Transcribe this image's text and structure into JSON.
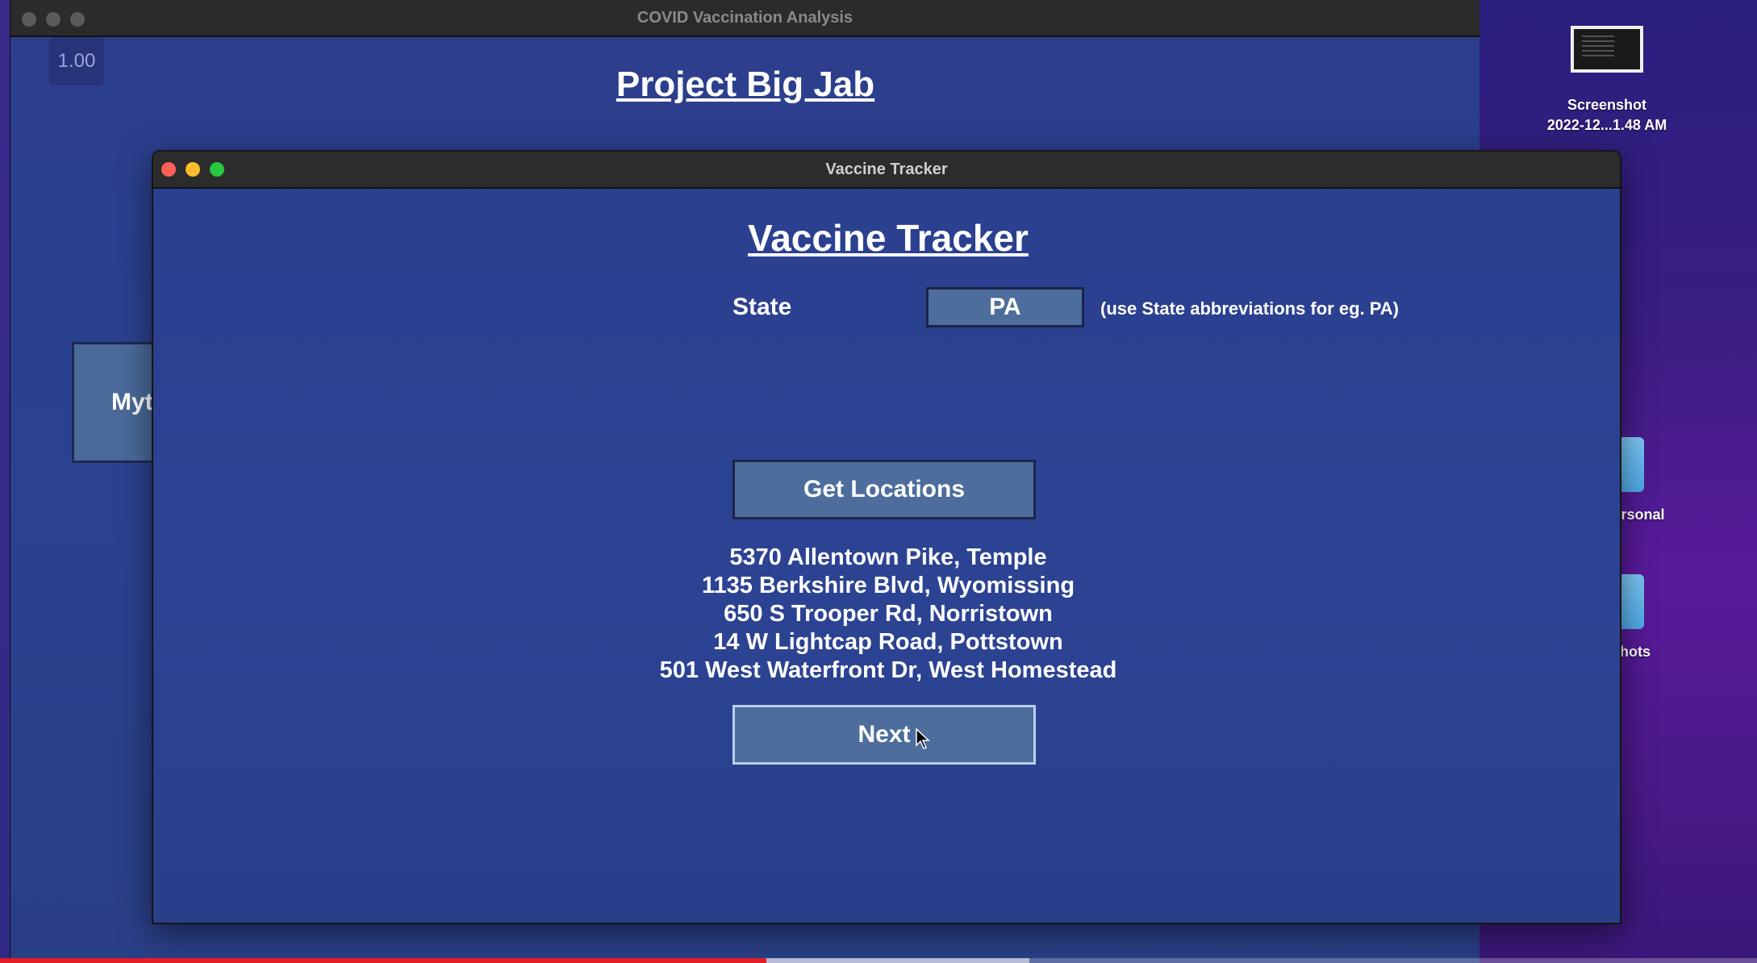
{
  "desktop": {
    "items": [
      {
        "label_line1": "Screenshot",
        "label_line2": "2022-12...1.48 AM",
        "icon": "screenshot-thumbnail-icon"
      },
      {
        "label": "Jainam Personal",
        "icon": "folder-icon"
      },
      {
        "label": "Screenshots",
        "icon": "folder-icon"
      }
    ]
  },
  "back_window": {
    "title": "COVID Vaccination Analysis",
    "zoom": "1.00",
    "heading": "Project Big Jab",
    "myth_button_label": "Myt"
  },
  "front_window": {
    "title": "Vaccine Tracker",
    "heading": "Vaccine Tracker",
    "state_label": "State",
    "state_value": "PA",
    "state_hint": "(use State abbreviations for eg. PA)",
    "get_locations_label": "Get Locations",
    "locations": [
      "5370 Allentown Pike, Temple",
      "1135 Berkshire Blvd, Wyomissing",
      "650 S Trooper Rd, Norristown",
      "14 W Lightcap Road, Pottstown",
      "501 West Waterfront Dr, West Homestead"
    ],
    "next_label": "Next"
  },
  "video_progress": {
    "played_fraction": 0.436,
    "buffered_fraction": 0.586,
    "color": "#e21e26"
  },
  "colors": {
    "window_bg": "#2b3f8e",
    "button_bg": "#4d6d9c",
    "titlebar": "#2c2c2c"
  }
}
